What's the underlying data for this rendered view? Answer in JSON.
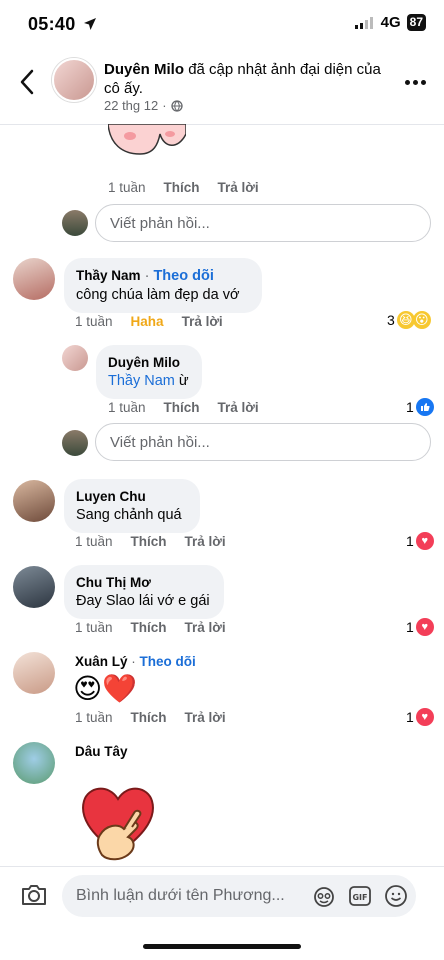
{
  "status": {
    "time": "05:40",
    "network": "4G",
    "battery": "87"
  },
  "header": {
    "name": "Duyên Milo",
    "action": "đã cập nhật ảnh đại diện của cô ấy.",
    "date": "22 thg 12",
    "date_sep": "·"
  },
  "labels": {
    "like": "Thích",
    "reply": "Trả lời",
    "haha": "Haha",
    "reply_placeholder": "Viết phản hồi...",
    "follow": "Theo dõi",
    "dot": "·"
  },
  "top_comment": {
    "time": "1 tuần"
  },
  "comments": [
    {
      "author": "Thầy Nam",
      "text": "công chúa làm đẹp da vớ",
      "time": "1 tuần",
      "reaction_count": "3"
    },
    {
      "author": "Duyên Milo",
      "mention": "Thầy Nam",
      "text": "ừ",
      "time": "1 tuần",
      "reaction_count": "1"
    },
    {
      "author": "Luyen Chu",
      "text": "Sang chảnh quá",
      "time": "1 tuần",
      "reaction_count": "1"
    },
    {
      "author": "Chu Thị Mơ",
      "text": "Đay Slao lái vớ e gái",
      "time": "1 tuần",
      "reaction_count": "1"
    },
    {
      "author": "Xuân Lý",
      "text": "😍❤️",
      "time": "1 tuần",
      "reaction_count": "1"
    },
    {
      "author": "Dâu Tây"
    }
  ],
  "composer": {
    "placeholder": "Bình luận dưới tên Phương..."
  },
  "colors": {
    "link": "#1b6ed7",
    "muted": "#65676b",
    "bubble": "#f0f2f5",
    "love": "#f33e58",
    "like": "#1877f2"
  }
}
